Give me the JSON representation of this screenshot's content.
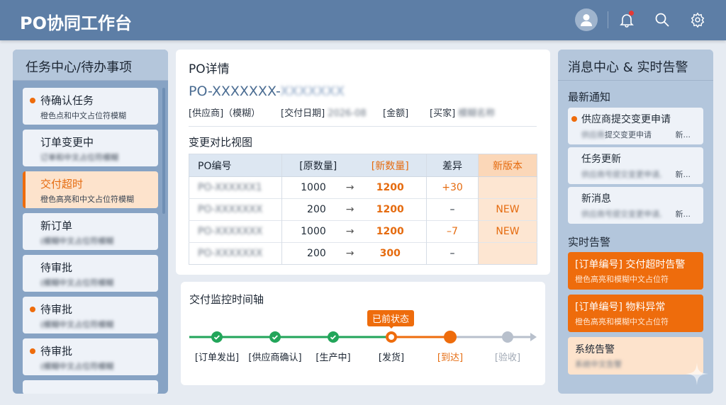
{
  "header": {
    "title": "PO协同工作台",
    "icons": [
      "user-avatar-icon",
      "bell-icon",
      "search-icon",
      "gear-icon"
    ]
  },
  "tasks": {
    "title": "任务中心/待办事项",
    "items": [
      {
        "title": "待确认任务",
        "sub": "橙色点和中文占位符模糊",
        "dot": true,
        "active": false,
        "blur": false
      },
      {
        "title": "订单变更中",
        "sub": "订单和中文占位符模糊",
        "dot": false,
        "active": false,
        "blur": true
      },
      {
        "title": "交付超时",
        "sub": "橙色高亮和中文占位符模糊",
        "dot": false,
        "active": true,
        "blur": false
      },
      {
        "title": "新订单",
        "sub": "(模糊中文占位符模糊",
        "dot": false,
        "active": false,
        "blur": true
      },
      {
        "title": "待审批",
        "sub": "(模糊中文占位符模糊",
        "dot": false,
        "active": false,
        "blur": true
      },
      {
        "title": "待审批",
        "sub": "(模糊中文占位符模糊",
        "dot": true,
        "active": false,
        "blur": true
      },
      {
        "title": "待审批",
        "sub": "(模糊中文占位符模糊",
        "dot": true,
        "active": false,
        "blur": true
      }
    ]
  },
  "po": {
    "title": "PO详情",
    "id": "PO-XXXXXXX-",
    "id_blur": "XXXXXXX",
    "supplier_label": "[供应商]（模糊）",
    "date_label": "[交付日期]",
    "date_value": "2026-08",
    "amount_label": "[金额]",
    "buyer_label": "[买家]",
    "buyer_value": "模糊名称"
  },
  "compare": {
    "title": "变更对比视图",
    "headers": [
      "PO编号",
      "[原数量]",
      "[新数量]",
      "差异",
      "新版本"
    ],
    "arrow": "→",
    "rows": [
      {
        "po": "PO-XXXXXX1",
        "old": "1000",
        "new": "1200",
        "diff": "+30",
        "ver": ""
      },
      {
        "po": "PO-XXXXXXX",
        "old": "200",
        "new": "1200",
        "diff": "–",
        "ver": "NEW"
      },
      {
        "po": "PO-XXXXXXX",
        "old": "1000",
        "new": "1200",
        "diff": "–7",
        "ver": "NEW"
      },
      {
        "po": "PO-XXXXXXX",
        "old": "200",
        "new": "300",
        "diff": "–",
        "ver": ""
      }
    ]
  },
  "timeline": {
    "title": "交付监控时间轴",
    "tooltip": "已前状态",
    "steps": [
      {
        "label": "[订单发出]",
        "state": "done"
      },
      {
        "label": "[供应商确认]",
        "state": "done"
      },
      {
        "label": "[生产中]",
        "state": "done"
      },
      {
        "label": "[发货]",
        "state": "current"
      },
      {
        "label": "[到达]",
        "state": "next"
      },
      {
        "label": "[验收]",
        "state": "pending"
      }
    ]
  },
  "messages": {
    "title": "消息中心 & 实时告警",
    "notice_title": "最新通知",
    "notices": [
      {
        "title": "供应商提交变更申请",
        "sub_blur": "供应商",
        "sub": "提交变更申请",
        "more": "新...",
        "dot": true
      },
      {
        "title": "任务更新",
        "sub_blur": "供应商号提交变更申请,",
        "sub": "",
        "more": "新...",
        "dot": false
      },
      {
        "title": "新消息",
        "sub_blur": "供应商号提交变更申请,",
        "sub": "",
        "more": "新...",
        "dot": false
      }
    ],
    "alert_title": "实时告警",
    "alerts": [
      {
        "title": "[订单编号] 交付超时告警",
        "sub": "橙色高亮和模糊中文占位符"
      },
      {
        "title": "[订单编号] 物料异常",
        "sub": "橙色高亮和模糊中文占位符"
      }
    ],
    "system": {
      "title": "系统告警",
      "sub": "系统中文告警"
    }
  },
  "colors": {
    "header": "#5d7ea6",
    "accent": "#ee6c0c",
    "done": "#22a55a",
    "pending": "#b8c0cc"
  }
}
